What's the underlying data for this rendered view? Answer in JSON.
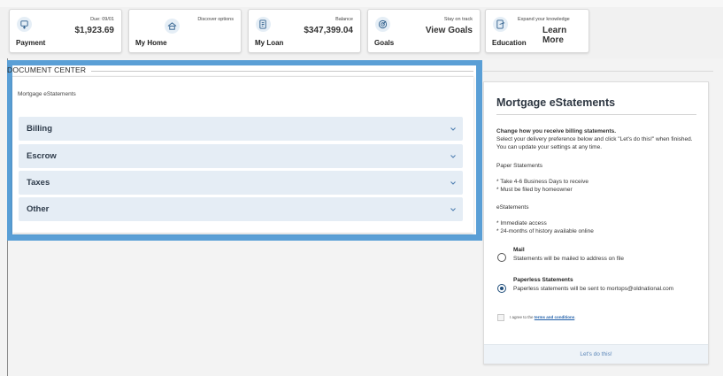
{
  "tiles": {
    "payment": {
      "label": "Payment",
      "small": "Due: 09/01",
      "big": "$1,923.69",
      "icon": "payment-icon"
    },
    "home": {
      "label": "My Home",
      "small": "Discover options",
      "big": "",
      "icon": "home-icon"
    },
    "loan": {
      "label": "My Loan",
      "small": "Balance",
      "big": "$347,399.04",
      "icon": "loan-icon"
    },
    "goals": {
      "label": "Goals",
      "small": "Stay on track",
      "big": "View Goals",
      "icon": "target-icon"
    },
    "education": {
      "label": "Education",
      "small": "Expand your knowledge",
      "big": "Learn More",
      "icon": "education-icon"
    }
  },
  "document_center": {
    "title": "DOCUMENT CENTER",
    "subtitle": "Mortgage eStatements",
    "sections": [
      "Billing",
      "Escrow",
      "Taxes",
      "Other"
    ]
  },
  "estatements": {
    "title": "Mortgage eStatements",
    "heading": "Change how you receive billing statements.",
    "intro": "Select your delivery preference below and click \"Let's do this!\" when finished.  You can update your settings at any time.",
    "paper_heading": "Paper Statements",
    "paper_bullet_1": "* Take 4-6 Business Days to receive",
    "paper_bullet_2": "* Must be filed by homeowner",
    "e_heading": "eStatements",
    "e_bullet_1": "* Immediate access",
    "e_bullet_2": "* 24-months of history available online",
    "options": [
      {
        "title": "Mail",
        "desc": "Statements will be mailed to address on file",
        "selected": false
      },
      {
        "title": "Paperless Statements",
        "desc": "Paperless statements will be sent to mortops@oldnational.com",
        "selected": true
      }
    ],
    "agree_prefix": "I agree to the",
    "agree_link": "terms and conditions",
    "agree_suffix": ".",
    "cta": "Let's do this!"
  },
  "colors": {
    "accent": "#5a9fd6",
    "accordion_bg": "#e5edf5",
    "link": "#1f5ea8"
  }
}
